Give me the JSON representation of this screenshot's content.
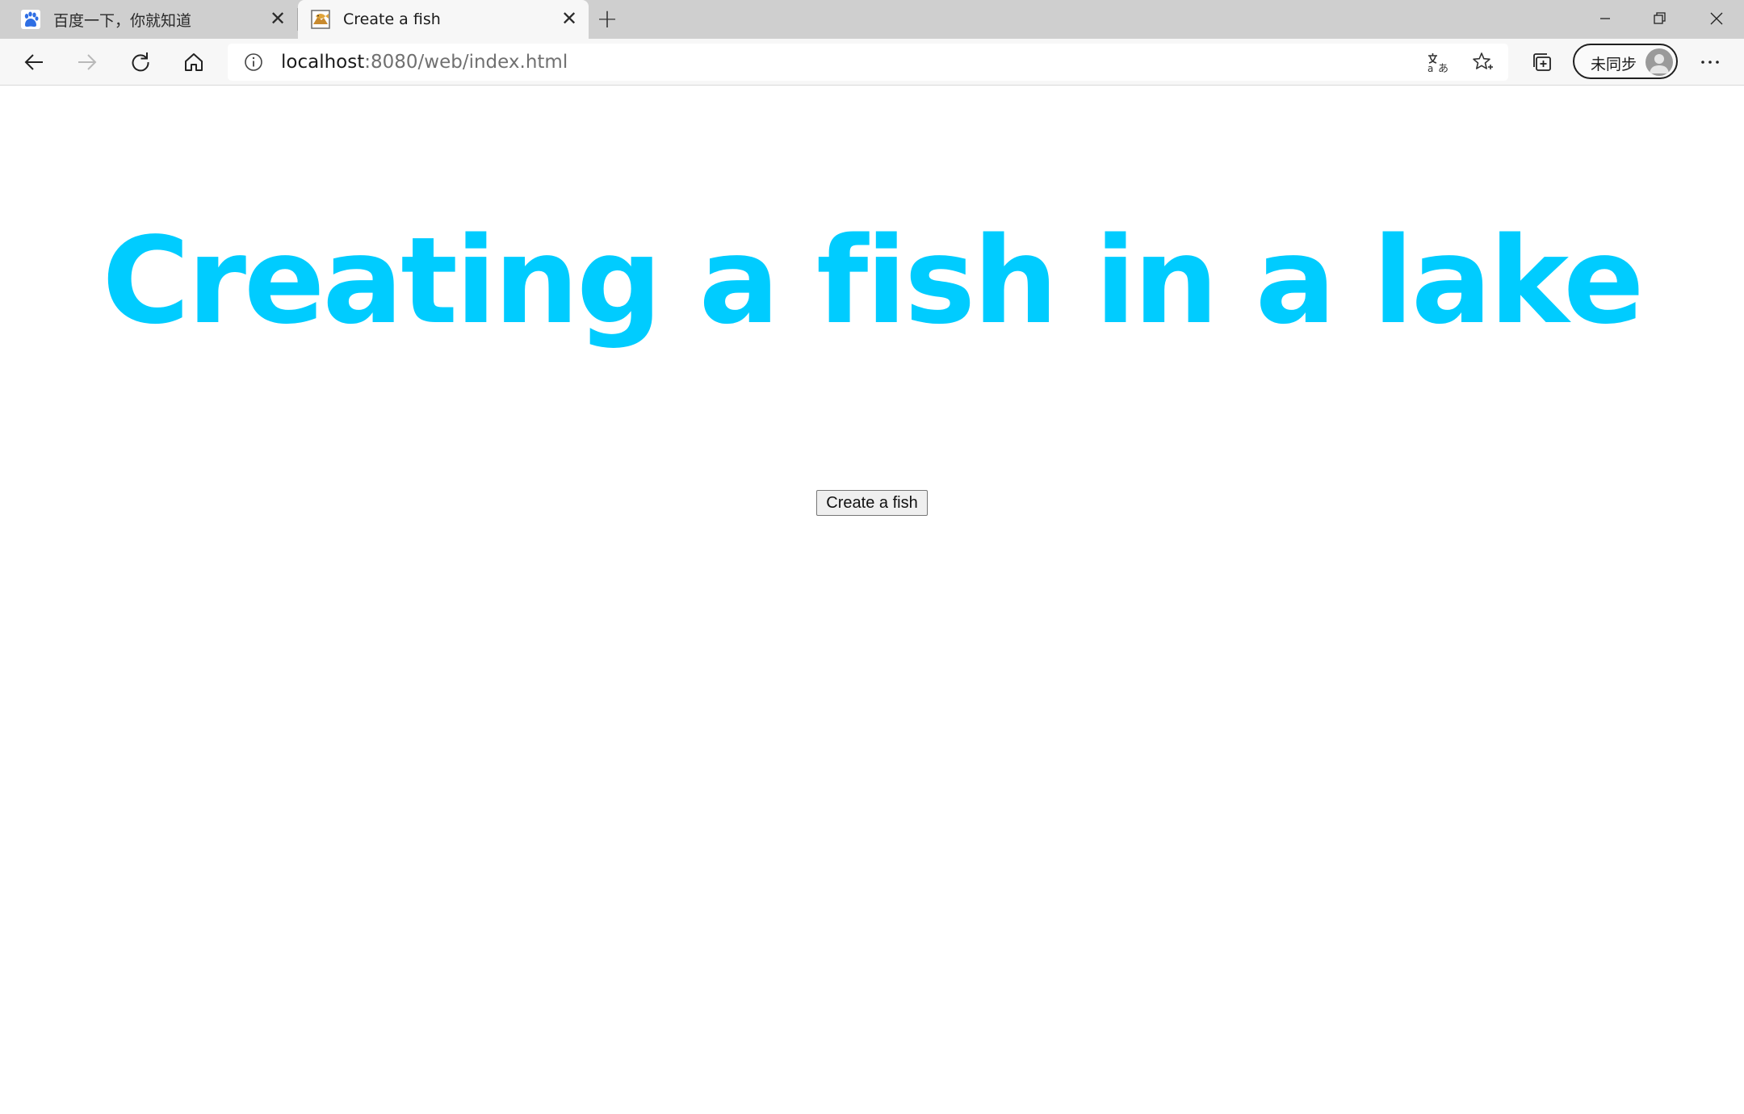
{
  "browser": {
    "tabs": [
      {
        "title": "百度一下，你就知道",
        "favicon": "baidu-paw-icon",
        "active": false
      },
      {
        "title": "Create a fish",
        "favicon": "fish-image-icon",
        "active": true
      }
    ],
    "new_tab_glyph": "+",
    "address": {
      "host": "localhost",
      "path": ":8080/web/index.html"
    },
    "profile": {
      "label": "未同步",
      "icon": "person-avatar-icon"
    }
  },
  "page": {
    "heading": "Creating a fish in a lake",
    "heading_color": "#00ccff",
    "button_label": "Create a fish"
  }
}
